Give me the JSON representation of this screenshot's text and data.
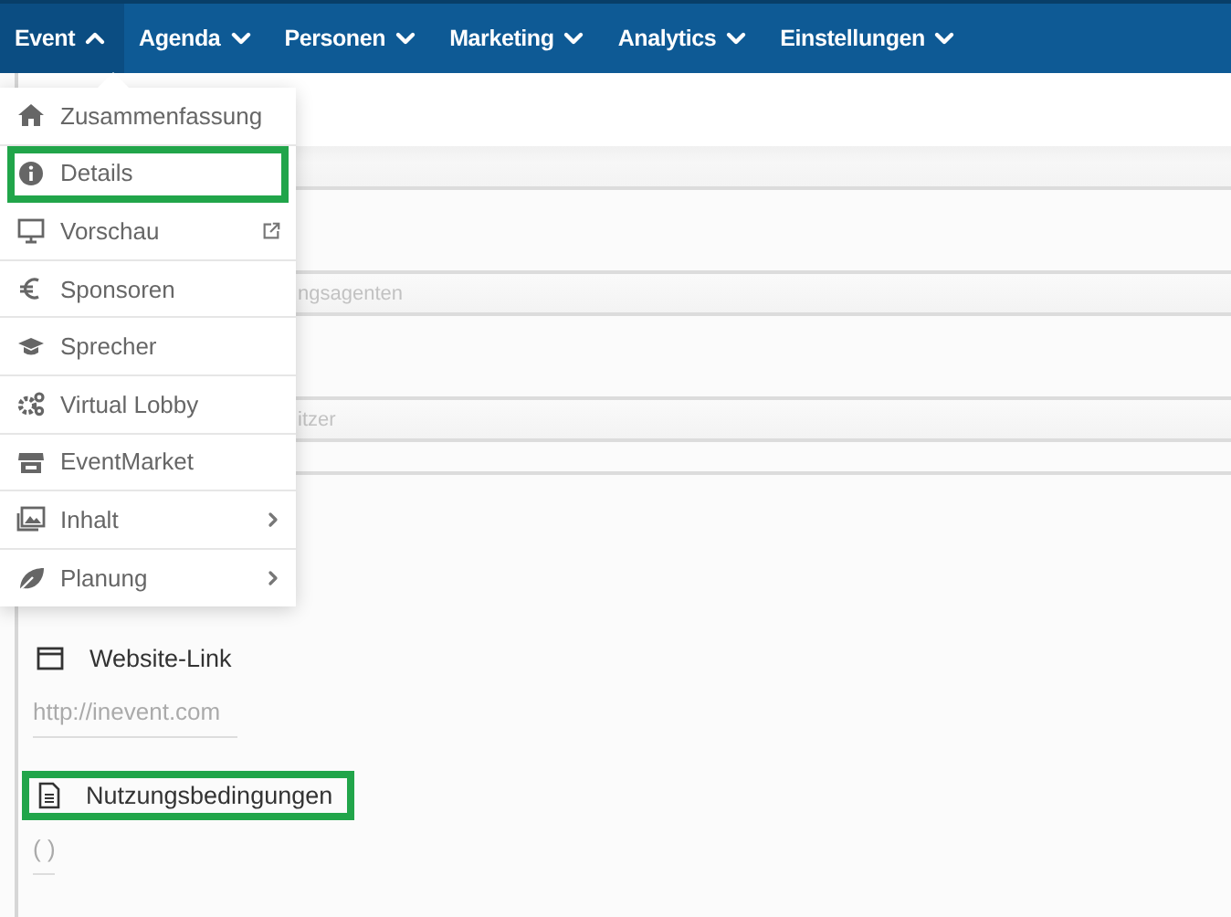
{
  "nav": {
    "tabs": [
      {
        "label": "Event",
        "selected": true,
        "expanded": true
      },
      {
        "label": "Agenda",
        "selected": false,
        "expanded": false
      },
      {
        "label": "Personen",
        "selected": false,
        "expanded": false
      },
      {
        "label": "Marketing",
        "selected": false,
        "expanded": false
      },
      {
        "label": "Analytics",
        "selected": false,
        "expanded": false
      },
      {
        "label": "Einstellungen",
        "selected": false,
        "expanded": false
      }
    ]
  },
  "menu": {
    "items": [
      {
        "label": "Zusammenfassung",
        "kind": "link",
        "highlighted": false
      },
      {
        "label": "Details",
        "kind": "link",
        "highlighted": true
      },
      {
        "label": "Vorschau",
        "kind": "external",
        "highlighted": false
      },
      {
        "label": "Sponsoren",
        "kind": "link",
        "highlighted": false
      },
      {
        "label": "Sprecher",
        "kind": "link",
        "highlighted": false
      },
      {
        "label": "Virtual Lobby",
        "kind": "link",
        "highlighted": false
      },
      {
        "label": "EventMarket",
        "kind": "link",
        "highlighted": false
      },
      {
        "label": "Inhalt",
        "kind": "submenu",
        "highlighted": false
      },
      {
        "label": "Planung",
        "kind": "submenu",
        "highlighted": false
      }
    ]
  },
  "form": {
    "hidden_fields": [
      {
        "placeholder": "ngsagenten"
      },
      {
        "placeholder": "itzer"
      }
    ],
    "sections": [
      {
        "label": "Website-Link",
        "placeholder": "http://inevent.com",
        "highlighted": false
      },
      {
        "label": "Nutzungsbedingungen",
        "value": "( )",
        "highlighted": true
      }
    ]
  }
}
